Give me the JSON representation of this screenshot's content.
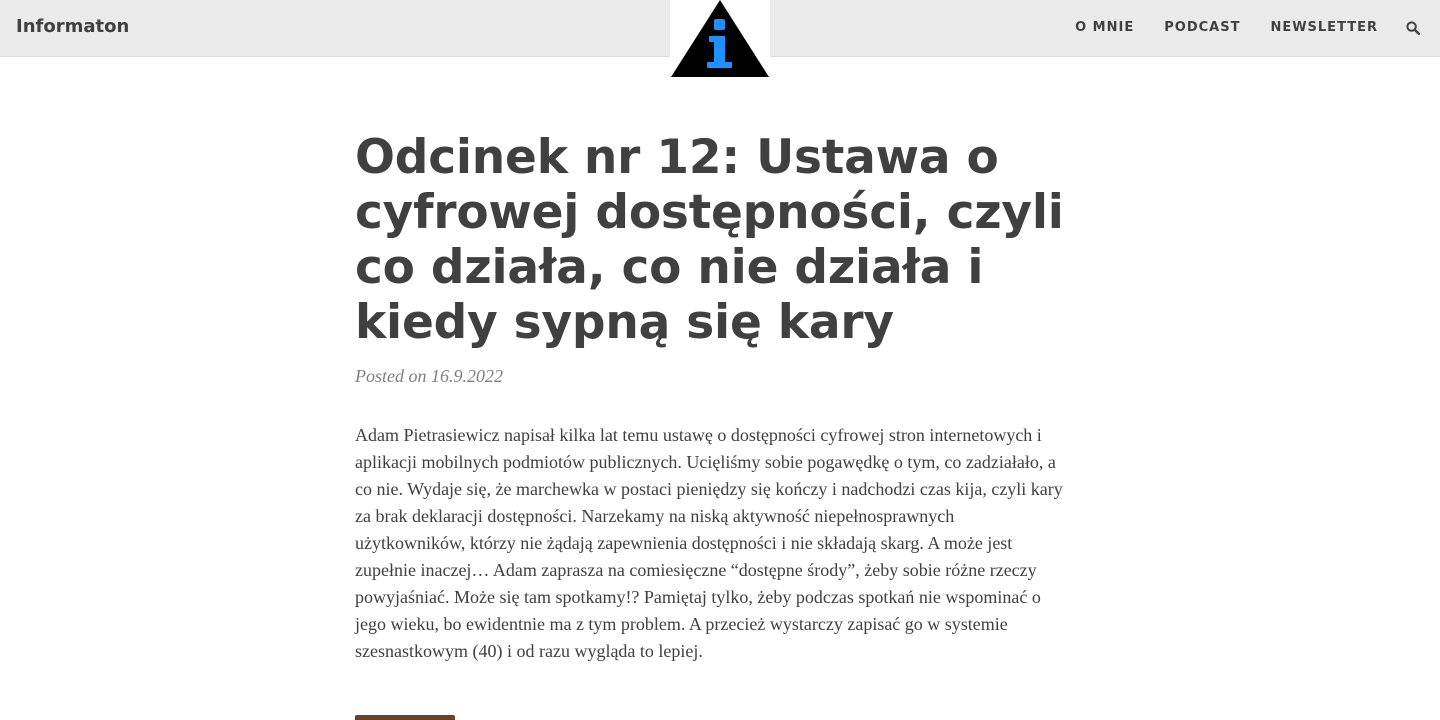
{
  "site": {
    "brand": "Informaton"
  },
  "nav": {
    "items": [
      {
        "label": "O MNIE"
      },
      {
        "label": "PODCAST"
      },
      {
        "label": "NEWSLETTER"
      }
    ],
    "search_icon": "search-icon"
  },
  "logo": {
    "icon": "info-triangle-logo",
    "colors": {
      "triangle": "#000000",
      "glyph": "#1e90ff"
    }
  },
  "post": {
    "title": "Odcinek nr 12: Ustawa o cyfrowej dostępności, czyli co działa, co nie działa i kiedy sypną się kary",
    "meta": "Posted on 16.9.2022",
    "body": "Adam Pietrasiewicz napisał kilka lat temu ustawę o dostępności cyfrowej stron internetowych i aplikacji mobilnych podmiotów publicznych. Ucięliśmy sobie pogawędkę o tym, co zadziałało, a co nie. Wydaje się, że marchewka w postaci pieniędzy się kończy i nadchodzi czas kija, czyli kary za brak deklaracji dostępności. Narzekamy na niską aktywność niepełnosprawnych użytkowników, którzy nie żądają zapewnienia dostępności i nie składają skarg. A może jest zupełnie inaczej… Adam zaprasza na comiesięczne “dostępne środy”, żeby sobie różne rzeczy powyjaśniać. Może się tam spotkamy!? Pamiętaj tylko, żeby podczas spotkań nie wspominać o jego wieku, bo ewidentnie ma z tym problem. A przecież wystarczy zapisać go w systemie szesnastkowym (40) i od razu wygląda to lepiej."
  },
  "colors": {
    "navbar_bg": "#eaeaea",
    "text": "#404040",
    "meta": "#808080",
    "button": "#6b4226"
  }
}
